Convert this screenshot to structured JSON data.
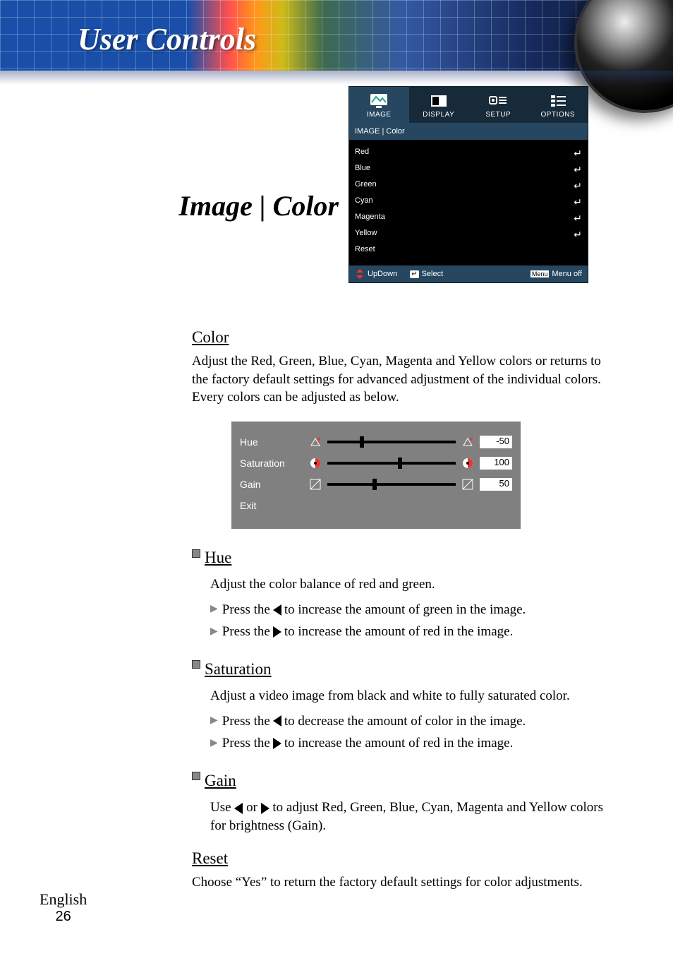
{
  "banner": {
    "title": "User Controls"
  },
  "section_title": "Image | Color",
  "osd": {
    "tabs": [
      "IMAGE",
      "DISPLAY",
      "SETUP",
      "OPTIONS"
    ],
    "breadcrumb": "IMAGE | Color",
    "items": [
      "Red",
      "Blue",
      "Green",
      "Cyan",
      "Magenta",
      "Yellow",
      "Reset"
    ],
    "footer": {
      "updown": "UpDown",
      "select": "Select",
      "menuoff": "Menu off",
      "menu_key": "Menu"
    }
  },
  "adjust": {
    "rows": [
      {
        "label": "Hue",
        "value": "-50"
      },
      {
        "label": "Saturation",
        "value": "100"
      },
      {
        "label": "Gain",
        "value": "50"
      },
      {
        "label": "Exit",
        "value": ""
      }
    ]
  },
  "body": {
    "color_h": "Color",
    "color_p": "Adjust the Red, Green, Blue, Cyan, Magenta and Yellow colors or returns to the factory default settings for advanced adjustment of the individual colors. Every colors can be adjusted as below.",
    "hue_h": "Hue",
    "hue_p": "Adjust the color balance of red and green.",
    "hue_b1a": "Press the ",
    "hue_b1b": " to increase the amount of green in the image.",
    "hue_b2a": "Press the ",
    "hue_b2b": " to increase the amount of red in the image.",
    "sat_h": "Saturation",
    "sat_p": "Adjust a video image from black and white to fully saturated color.",
    "sat_b1a": "Press the ",
    "sat_b1b": " to decrease the amount of color in the image.",
    "sat_b2a": "Press the ",
    "sat_b2b": " to increase the amount of red in the image.",
    "gain_h": "Gain",
    "gain_p1": "Use ",
    "gain_p2": " or ",
    "gain_p3": " to adjust Red, Green, Blue, Cyan, Magenta and Yellow colors for brightness (Gain).",
    "reset_h": "Reset",
    "reset_p": "Choose “Yes” to return the factory default settings for color adjustments."
  },
  "footer": {
    "lang": "English",
    "page": "26"
  }
}
